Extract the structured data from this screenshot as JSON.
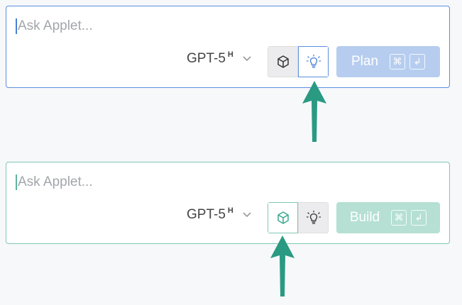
{
  "panels": {
    "plan": {
      "placeholder": "Ask Applet...",
      "model": "GPT-5",
      "model_sup": "H",
      "action_label": "Plan",
      "cmd_key": "⌘",
      "enter_key": "↲"
    },
    "build": {
      "placeholder": "Ask Applet...",
      "model": "GPT-5",
      "model_sup": "H",
      "action_label": "Build",
      "cmd_key": "⌘",
      "enter_key": "↲"
    }
  },
  "colors": {
    "plan_accent": "#5b8fe0",
    "build_accent": "#7fc7b4",
    "arrow": "#2a9a82"
  },
  "icons": {
    "mode_1": "cube-icon",
    "mode_2": "lightbulb-icon"
  },
  "state": {
    "plan_panel_active_mode": "lightbulb",
    "build_panel_active_mode": "cube"
  }
}
